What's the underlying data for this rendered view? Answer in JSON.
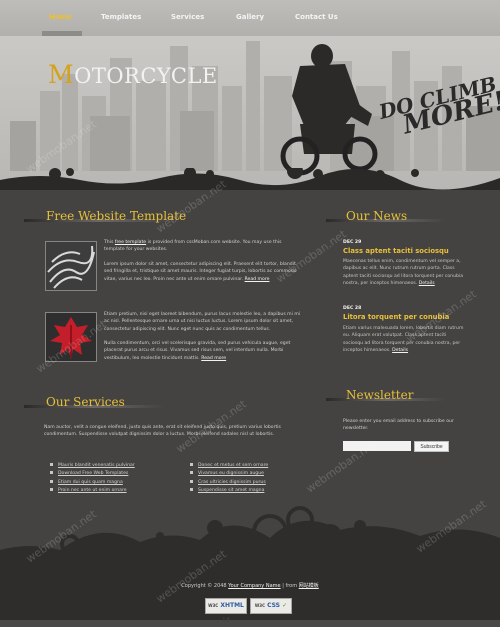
{
  "nav": {
    "items": [
      "Home",
      "Templates",
      "Services",
      "Gallery",
      "Contact Us"
    ]
  },
  "brand": {
    "first_letter": "M",
    "rest": "OTORCYCLE",
    "graffiti_line1": "DO CLIMB",
    "graffiti_line2": "MORE!"
  },
  "sections": {
    "free_template_title": "Free Website Template",
    "news_title": "Our News",
    "services_title": "Our Services",
    "newsletter_title": "Newsletter"
  },
  "intro": {
    "p1_pre": "This ",
    "p1_link": "free template",
    "p1_post": " is provided from cssMoban.com website. You may use this template for your websites.",
    "p2": "Lorem ipsum dolor sit amet, consectetur adipiscing elit. Praesent elit tortor, blandit sed fringilla et, tristique sit amet mauris. Integer fugiat turpis, lobortis ac commodo vitae, varius nec leo. Proin nec ante ut enim ornare pulvinar.",
    "read_more_1": "Read more",
    "p3": "Etiam pretium, nisi eget laoreet bibendum, purus lacus molestie leo, a dapibus mi mi ac nisl. Pellentesque ornare urna ut nisi luctus luctus. Lorem ipsum dolor sit amet, consectetur adipiscing elit. Nunc eget nunc quis ac condimentum tellus.",
    "p4": "Nulla condimentum, orci vel scelerisque gravida, sed purus vehicula augue, eget placerat purus arcu et risus. Vivamus sed risus sem, vel interdum nulla. Morbi vestibulum, leo molestie tincidunt mattis.",
    "read_more_2": "Read more"
  },
  "news": [
    {
      "date": "DEC 29",
      "title": "Class aptent taciti sociosqu",
      "body": "Maecenas tellus enim, condimentum vel semper a, dapibus ac elit. Nunc rutrum rutrum porta. Class aptent taciti sociosqu ad litora torquent per conubia nostra, per inceptos himenaeos.",
      "details": "Details"
    },
    {
      "date": "DEC 28",
      "title": "Litora torquent per conubia",
      "body": "Etiam varius malesuada lorem, lobortis diam rutrum eu. Aliquam erat volutpat. Class aptent taciti sociosqu ad litora torquent per conubia nostra, per inceptos himenaeos.",
      "details": "Details"
    }
  ],
  "services": {
    "intro": "Nam auctor, velit a congue eleifend, justo quis ante, erat sit eleifend justo quis, pretium varius lobortis condimentum. Suspendisse volutpat dignissim dolor a luctus. Morbi eleifend sodales nisl ut lobortis.",
    "col1": [
      "Mauris blandit venenatis pulvinar",
      "Download Free Web Templates",
      "Etiam dui quis quam magna",
      "Proin nec ante ut enim ornare"
    ],
    "col2": [
      "Donec et metus et sem ornare",
      "Vivamus eu dignissim augue",
      "Cras ultricies dignissim purus",
      "Suspendisse sit amet magna"
    ]
  },
  "newsletter": {
    "text": "Please enter you email address to subscribe our newsletter.",
    "input_value": "",
    "button": "Subscribe"
  },
  "footer": {
    "pre": "Copyright © 2048 ",
    "company": "Your Company Name",
    "mid": " | from ",
    "source": "网站模板"
  },
  "badges": {
    "xhtml_top": "W3C",
    "xhtml_label": "XHTML",
    "xhtml_ver": "1.0",
    "css_top": "W3C",
    "css_label": "CSS"
  },
  "watermark": "webmoban.net",
  "colors": {
    "accent": "#e7c13a",
    "logo_first": "#d4a21c",
    "body_bg": "#454341",
    "footer_bg": "#2e2d2c"
  }
}
